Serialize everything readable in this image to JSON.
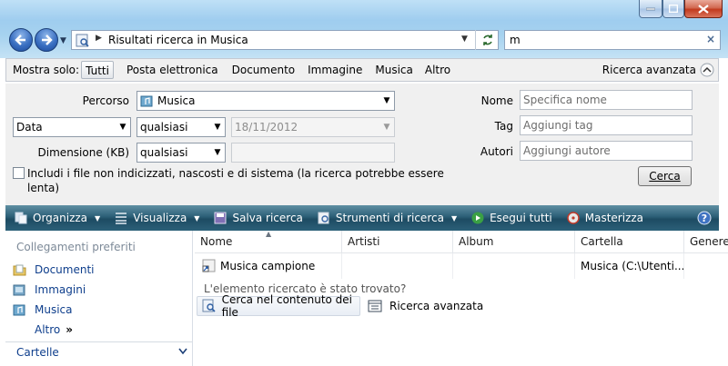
{
  "window": {
    "address_path": "Risultati ricerca in Musica",
    "search_query": "m"
  },
  "filterbar": {
    "show_label": "Mostra solo:",
    "filters": [
      "Tutti",
      "Posta elettronica",
      "Documento",
      "Immagine",
      "Musica",
      "Altro"
    ],
    "advanced_search": "Ricerca avanzata"
  },
  "advanced": {
    "path_label": "Percorso",
    "path_value": "Musica",
    "date_field": "Data",
    "date_operator": "qualsiasi",
    "date_value": "18/11/2012",
    "size_label": "Dimensione (KB)",
    "size_operator": "qualsiasi",
    "size_value": "",
    "include_checkbox_line1": "Includi i file non indicizzati, nascosti e di sistema (la ricerca potrebbe essere",
    "include_checkbox_line2": "lenta)",
    "name_label": "Nome",
    "name_placeholder": "Specifica nome",
    "tag_label": "Tag",
    "tag_placeholder": "Aggiungi tag",
    "authors_label": "Autori",
    "authors_placeholder": "Aggiungi autore",
    "search_button": "Cerca"
  },
  "toolbar": {
    "organize": "Organizza",
    "view": "Visualizza",
    "save_search": "Salva ricerca",
    "search_tools": "Strumenti di ricerca",
    "run_all": "Esegui tutti",
    "burn": "Masterizza"
  },
  "navpane": {
    "favorites_header": "Collegamenti preferiti",
    "links": [
      "Documenti",
      "Immagini",
      "Musica"
    ],
    "more": "Altro",
    "folders_header": "Cartelle"
  },
  "filelist": {
    "columns": [
      "Nome",
      "Artisti",
      "Album",
      "Cartella",
      "Genere"
    ],
    "rows": [
      {
        "name": "Musica campione",
        "artists": "",
        "album": "",
        "folder": "Musica (C:\\Utenti..."
      }
    ],
    "found_prompt": "L'elemento ricercato è stato trovato?",
    "search_contents": "Cerca nel contenuto dei file",
    "advanced_search": "Ricerca avanzata"
  },
  "colors": {
    "toolbar_dark": "#1d4b62",
    "link_blue": "#0e3e8c",
    "glass": "#a6d2ef"
  }
}
